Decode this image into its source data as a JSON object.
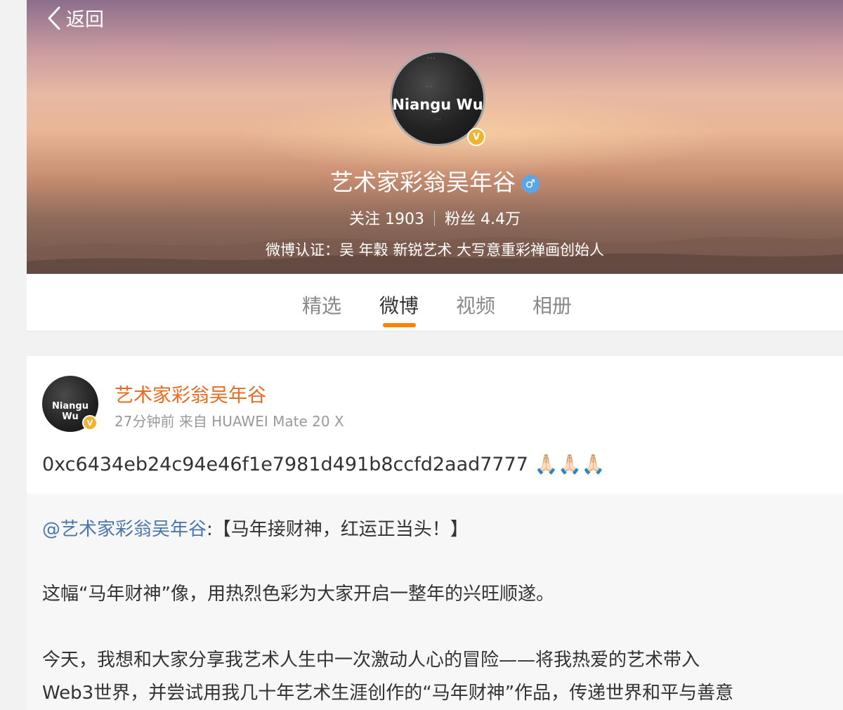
{
  "header": {
    "back_label": "返回",
    "avatar_text": "Niangu Wu",
    "profile_name": "艺术家彩翁吴年谷",
    "gender_symbol": "♂",
    "following_label": "关注 1903",
    "followers_label": "粉丝 4.4万",
    "verification": "微博认证：吴 年穀 新锐艺术 大写意重彩禅画创始人"
  },
  "tabs": [
    {
      "label": "精选",
      "active": false
    },
    {
      "label": "微博",
      "active": true
    },
    {
      "label": "视频",
      "active": false
    },
    {
      "label": "相册",
      "active": false
    }
  ],
  "post": {
    "avatar_text": "Niangu Wu",
    "author": "艺术家彩翁吴年谷",
    "meta": "27分钟前 来自 HUAWEI Mate 20 X",
    "text": "0xc6434eb24c94e46f1e7981d491b8ccfd2aad7777 🙏🏻🙏🏻🙏🏻",
    "repost": {
      "mention": "@艺术家彩翁吴年谷",
      "line1_rest": ":【马年接财神，红运正当头！】",
      "line2": "这幅“马年财神”像，用热烈色彩为大家开启一整年的兴旺顺遂。",
      "line3": "今天，我想和大家分享我艺术人生中一次激动人心的冒险——将我热爱的艺术带入",
      "line4": "Web3世界，并尝试用我几十年艺术生涯创作的“马年财神”作品，传递世界和平与善意"
    }
  },
  "colors": {
    "accent_orange": "#ff8200",
    "author_orange": "#e86b1f",
    "mention_blue": "#4b77a8",
    "verified_gold": "#f2b430"
  },
  "icons": {
    "back": "chevron-left-icon",
    "verified": "verified-badge-icon",
    "gender": "male-gender-icon"
  }
}
